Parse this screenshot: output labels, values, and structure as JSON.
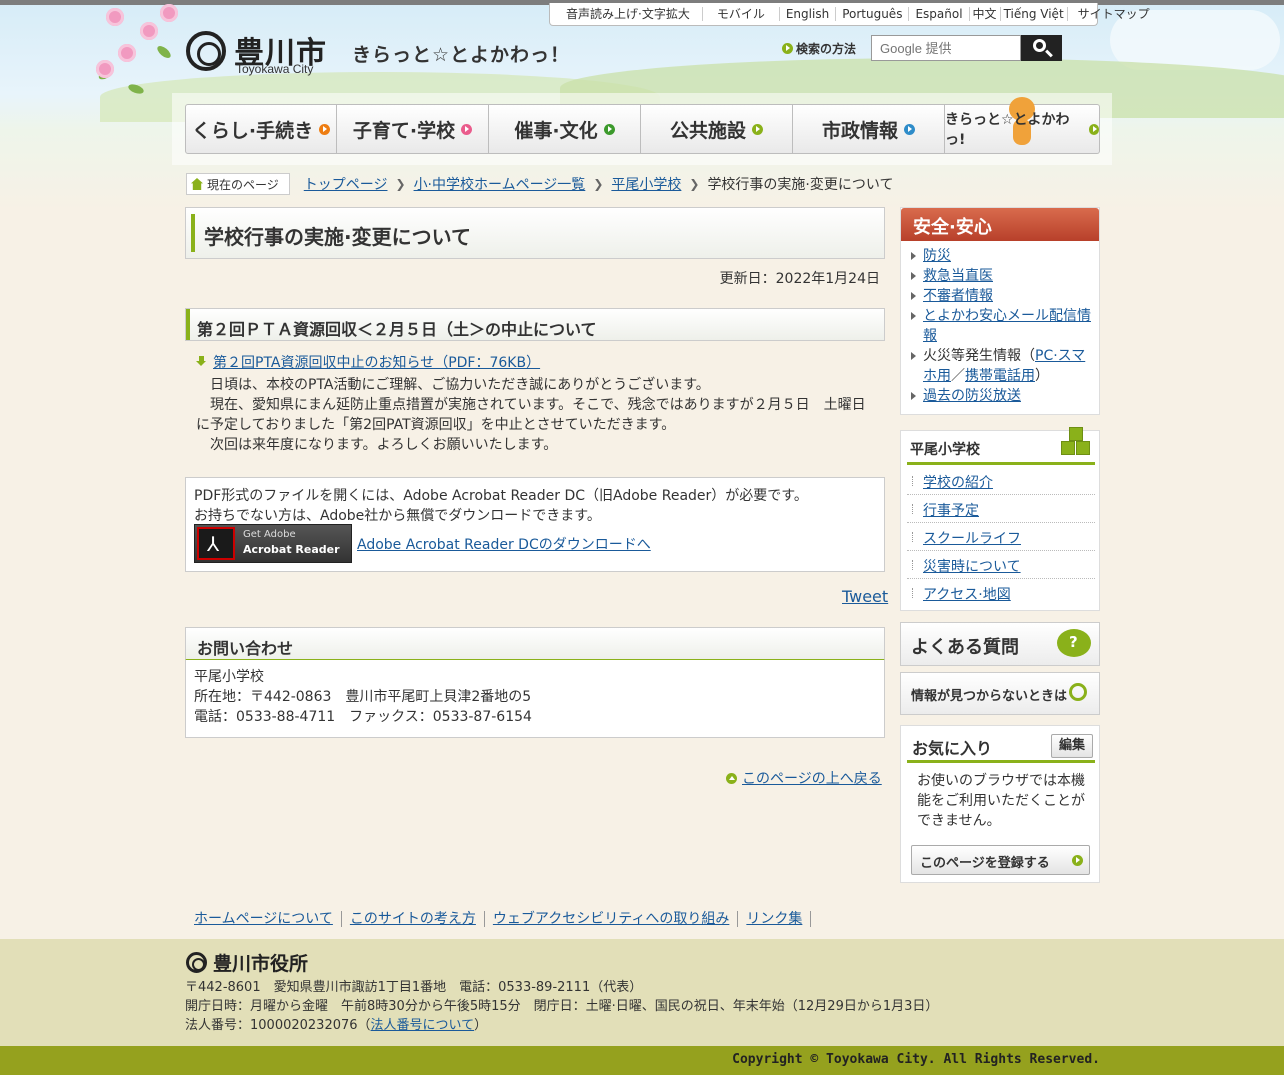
{
  "header": {
    "city_name": "豊川市",
    "city_name_en": "Toyokawa City",
    "catchphrase": "きらっと☆とよかわっ！",
    "util_links": [
      "音声読み上げ·文字拡大",
      "モバイル",
      "English",
      "Português",
      "Español",
      "中文",
      "Tiếng Việt",
      "サイトマップ"
    ],
    "search_help": "検索の方法",
    "search_placeholder": "Google 提供"
  },
  "nav": {
    "items": [
      {
        "label": "くらし·手続き",
        "color": "#ee7d12"
      },
      {
        "label": "子育て·学校",
        "color": "#ea5c8c"
      },
      {
        "label": "催事·文化",
        "color": "#3c9a2c"
      },
      {
        "label": "公共施設",
        "color": "#8ab11a"
      },
      {
        "label": "市政情報",
        "color": "#2e8cc9"
      },
      {
        "label": "きらっと☆とよかわっ!",
        "color": "#8ab11a"
      }
    ]
  },
  "breadcrumb": {
    "here_label": "現在のページ",
    "items": [
      "トップページ",
      "小·中学校ホームページ一覧",
      "平尾小学校"
    ],
    "current": "学校行事の実施·変更について"
  },
  "main": {
    "title": "学校行事の実施·変更について",
    "updated": "更新日：2022年1月24日",
    "section_title": "第２回ＰＴＡ資源回収＜２月５日（土＞の中止について",
    "pdf_link": "第２回PTA資源回収中止のお知らせ（PDF：76KB）",
    "paragraphs": [
      "日頃は、本校のPTA活動にご理解、ご協力いただき誠にありがとうございます。",
      "現在、愛知県にまん延防止重点措置が実施されています。そこで、残念ではありますが２月５日　土曜日に予定しておりました「第2回PAT資源回収」を中止とさせていただきます。",
      "次回は来年度になります。よろしくお願いいたします。"
    ],
    "adobe_line1": "PDF形式のファイルを開くには、Adobe Acrobat Reader DC（旧Adobe Reader）が必要です。",
    "adobe_line2": "お持ちでない方は、Adobe社から無償でダウンロードできます。",
    "adobe_badge_top": "Get Adobe",
    "adobe_badge_bottom": "Acrobat Reader",
    "adobe_link": "Adobe Acrobat Reader DCのダウンロードへ",
    "tweet": "Tweet",
    "contact_title": "お問い合わせ",
    "contact_lines": [
      "平尾小学校",
      "所在地：〒442-0863　豊川市平尾町上貝津2番地の5",
      "電話：0533-88-4711　ファックス：0533-87-6154"
    ],
    "page_top": "このページの上へ戻る"
  },
  "sidebar": {
    "safety_title": "安全·安心",
    "safety_items": [
      "防災",
      "救急当直医",
      "不審者情報",
      "とよかわ安心メール配信情報"
    ],
    "fire_prefix": "火災等発生情報（",
    "fire_link1": "PC·スマホ用",
    "fire_sep": "／",
    "fire_link2": "携帯電話用",
    "fire_suffix": "）",
    "safety_last": "過去の防災放送",
    "school_title": "平尾小学校",
    "school_items": [
      "学校の紹介",
      "行事予定",
      "スクールライフ",
      "災害時について",
      "アクセス·地図"
    ],
    "faq": "よくある質問",
    "notfound": "情報が見つからないときは",
    "fav_title": "お気に入り",
    "fav_edit": "編集",
    "fav_msg": "お使いのブラウザでは本機能をご利用いただくことができません。",
    "fav_register": "このページを登録する"
  },
  "footer": {
    "links": [
      "ホームページについて",
      "このサイトの考え方",
      "ウェブアクセシビリティへの取り組み",
      "リンク集"
    ],
    "org": "豊川市役所",
    "address": "〒442-8601　愛知県豊川市諏訪1丁目1番地　電話：0533-89-2111（代表）",
    "hours": "開庁日時：月曜から金曜　午前8時30分から午後5時15分　閉庁日：土曜·日曜、国民の祝日、年末年始（12月29日から1月3日）",
    "corp_prefix": "法人番号：1000020232076（",
    "corp_link": "法人番号について",
    "corp_suffix": "）",
    "copyright": "Copyright © Toyokawa City. All Rights Reserved."
  }
}
